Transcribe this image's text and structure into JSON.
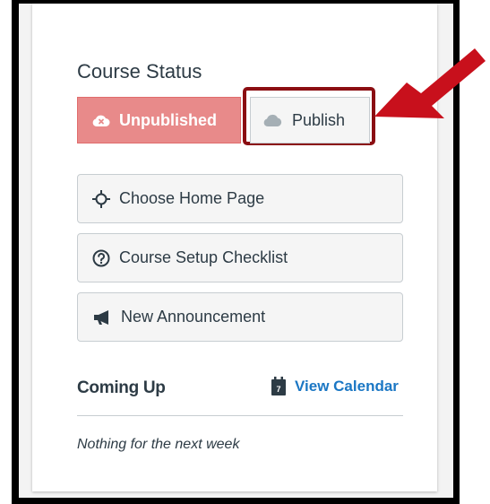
{
  "course_status": {
    "title": "Course Status",
    "unpublished_label": "Unpublished",
    "publish_label": "Publish"
  },
  "actions": [
    {
      "label": "Choose Home Page",
      "icon": "target-icon"
    },
    {
      "label": "Course Setup Checklist",
      "icon": "question-circle-icon"
    },
    {
      "label": "New Announcement",
      "icon": "megaphone-icon"
    }
  ],
  "coming_up": {
    "title": "Coming Up",
    "calendar_link": "View Calendar",
    "calendar_icon_day": "7",
    "empty_text": "Nothing for the next week"
  },
  "colors": {
    "unpublished_bg": "#e88a8a",
    "highlight_border": "#8b0e12",
    "arrow": "#c8101c",
    "link": "#1b77c4"
  }
}
